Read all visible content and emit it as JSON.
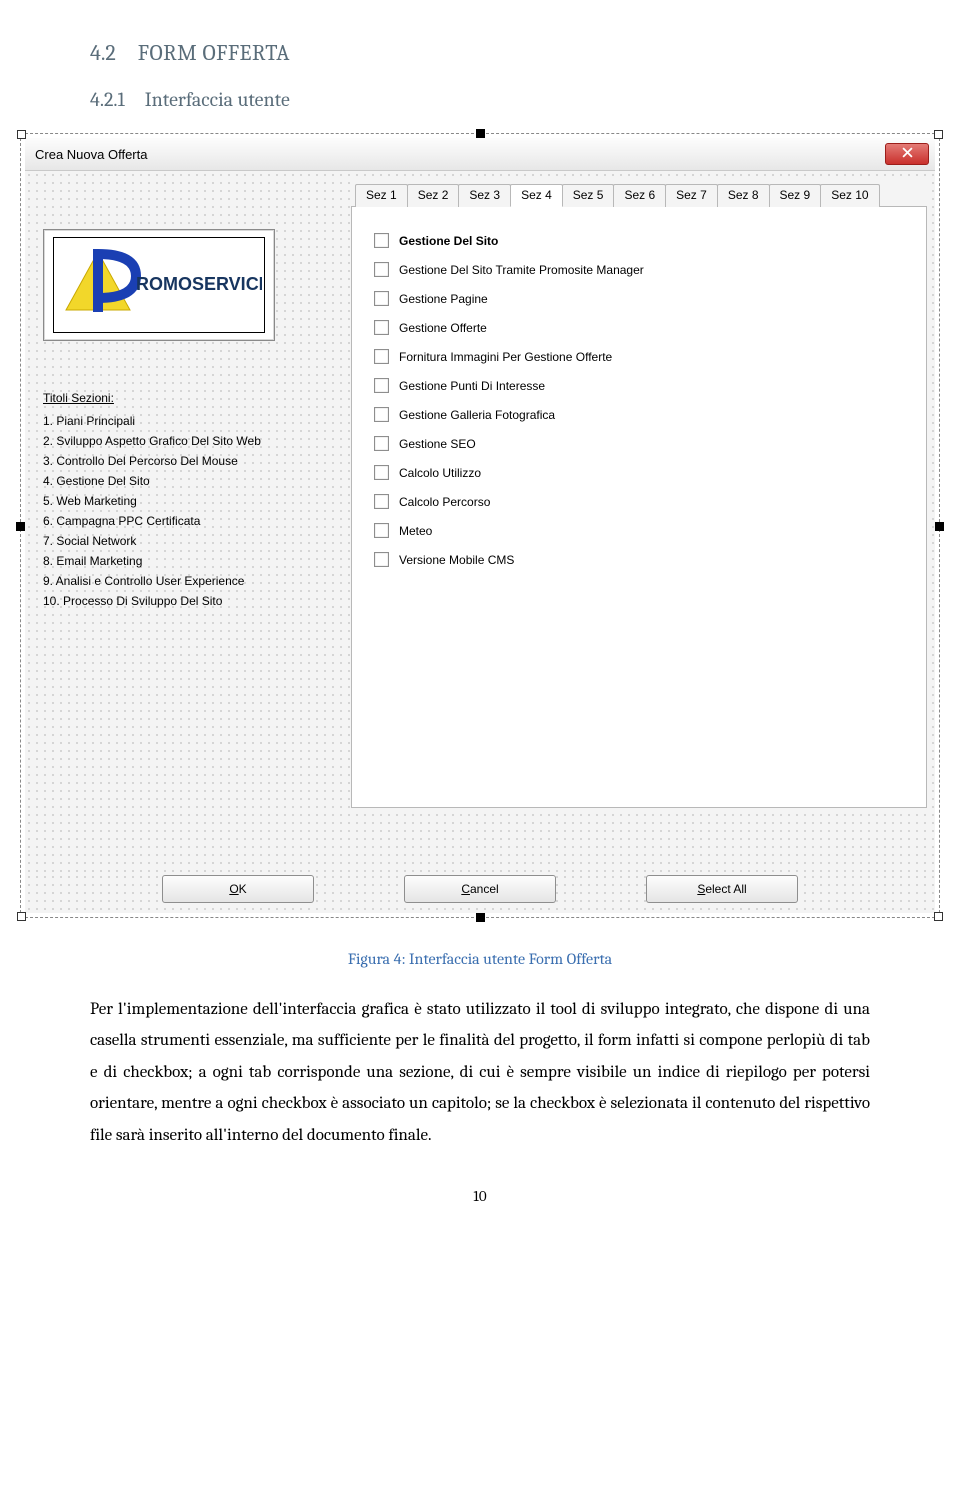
{
  "doc": {
    "section_number": "4.2",
    "section_title": "FORM OFFERTA",
    "subsection_number": "4.2.1",
    "subsection_title": "Interfaccia utente",
    "figure_caption": "Figura 4: Interfaccia utente Form Offerta",
    "body_paragraph": "Per l'implementazione dell'interfaccia grafica è stato utilizzato il tool di sviluppo integrato, che dispone di una casella strumenti essenziale, ma sufficiente per le finalità del progetto, il form infatti si compone perlopiù di tab e di checkbox; a ogni tab corrisponde una sezione, di cui è sempre visibile un indice di riepilogo per potersi orientare, mentre a ogni checkbox è associato un capitolo; se la checkbox è selezionata il contenuto del rispettivo file sarà inserito all'interno del documento finale.",
    "page_number": "10"
  },
  "form": {
    "title": "Crea Nuova Offerta",
    "tabs": [
      "Sez 1",
      "Sez 2",
      "Sez 3",
      "Sez 4",
      "Sez 5",
      "Sez 6",
      "Sez 7",
      "Sez 8",
      "Sez 9",
      "Sez 10"
    ],
    "active_tab_index": 3,
    "checkboxes": [
      {
        "label": "Gestione Del Sito",
        "bold": true
      },
      {
        "label": "Gestione Del Sito Tramite Promosite Manager",
        "bold": false
      },
      {
        "label": "Gestione Pagine",
        "bold": false
      },
      {
        "label": "Gestione Offerte",
        "bold": false
      },
      {
        "label": "Fornitura Immagini Per Gestione Offerte",
        "bold": false
      },
      {
        "label": "Gestione Punti Di Interesse",
        "bold": false
      },
      {
        "label": "Gestione Galleria Fotografica",
        "bold": false
      },
      {
        "label": "Gestione SEO",
        "bold": false
      },
      {
        "label": "Calcolo Utilizzo",
        "bold": false
      },
      {
        "label": "Calcolo Percorso",
        "bold": false
      },
      {
        "label": "Meteo",
        "bold": false
      },
      {
        "label": "Versione Mobile CMS",
        "bold": false
      }
    ],
    "titoli_heading": "Titoli Sezioni:",
    "titoli": [
      "1. Piani Principali",
      "2. Sviluppo Aspetto Grafico Del Sito Web",
      "3. Controllo Del Percorso Del Mouse",
      "4. Gestione Del Sito",
      "5. Web Marketing",
      "6. Campagna PPC Certificata",
      "7. Social Network",
      "8. Email Marketing",
      "9. Analisi e Controllo User Experience",
      "10. Processo Di Sviluppo Del Sito"
    ],
    "buttons": {
      "ok": "OK",
      "cancel": "Cancel",
      "select_all": "Select All"
    },
    "logo_text_top": "P",
    "logo_text_rest": "ROMOSERVICE"
  }
}
